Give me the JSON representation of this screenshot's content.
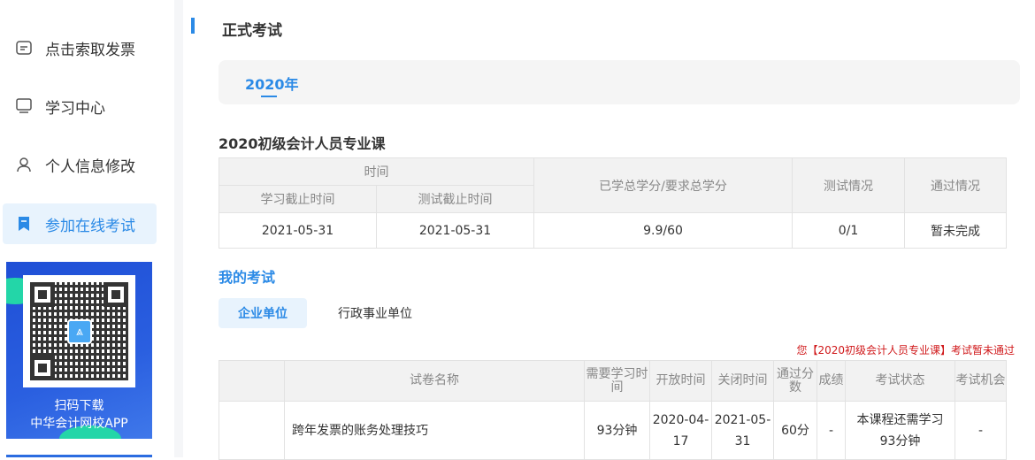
{
  "sidebar": {
    "items": [
      {
        "label": "点击索取发票",
        "icon": "invoice-icon"
      },
      {
        "label": "学习中心",
        "icon": "monitor-icon"
      },
      {
        "label": "个人信息修改",
        "icon": "user-icon"
      },
      {
        "label": "参加在线考试",
        "icon": "bookmark-icon",
        "active": true
      }
    ],
    "banner": {
      "line1": "扫码下载",
      "line2": "中华会计网校APP"
    }
  },
  "page": {
    "title": "正式考试",
    "year_tab": "2020年"
  },
  "course": {
    "title": "2020初级会计人员专业课",
    "headers": {
      "time": "时间",
      "study_deadline": "学习截止时间",
      "test_deadline": "测试截止时间",
      "credits": "已学总学分/要求总学分",
      "test": "测试情况",
      "pass": "通过情况"
    },
    "row": {
      "study_deadline": "2021-05-31",
      "test_deadline": "2021-05-31",
      "credits": "9.9/60",
      "test": "0/1",
      "pass": "暂未完成"
    }
  },
  "my_exam": {
    "title": "我的考试",
    "tabs": [
      "企业单位",
      "行政事业单位"
    ],
    "notice": "您【2020初级会计人员专业课】考试暂未通过",
    "headers": [
      "",
      "试卷名称",
      "需要学习时间",
      "开放时间",
      "关闭时间",
      "通过分数",
      "成绩",
      "考试状态",
      "考试机会"
    ],
    "rows": [
      {
        "blank": "",
        "name": "跨年发票的账务处理技巧",
        "study": "93分钟",
        "open": "2020-04-17",
        "close": "2021-05-31",
        "pass_score": "60分",
        "score": "-",
        "status": "本课程还需学习93分钟",
        "chances": "-"
      }
    ]
  }
}
